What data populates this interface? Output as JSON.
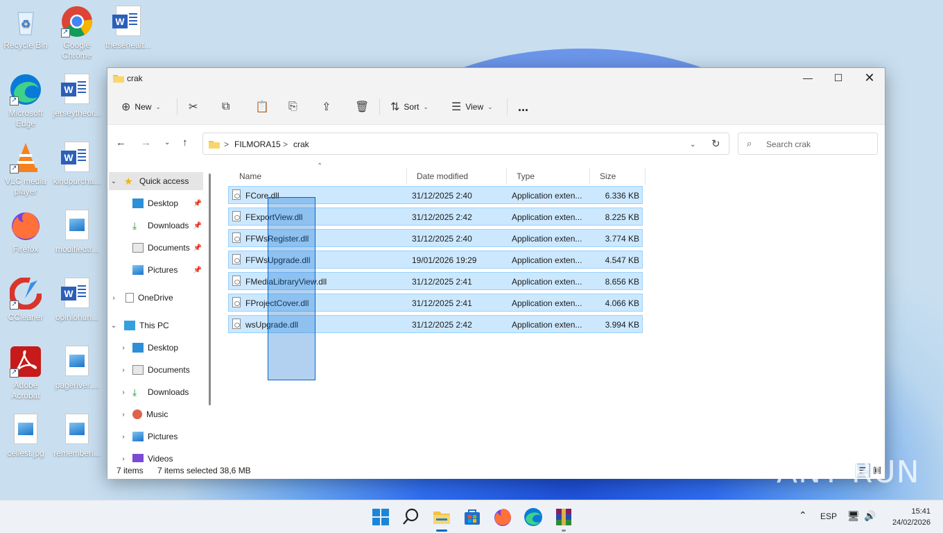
{
  "desktop": {
    "icons": [
      {
        "label": "Recycle Bin",
        "icon": "recycle-bin-icon"
      },
      {
        "label": "Google Chrome",
        "icon": "chrome-icon"
      },
      {
        "label": "thesehealt...",
        "icon": "word-doc-icon"
      },
      {
        "label": "Microsoft Edge",
        "icon": "edge-icon"
      },
      {
        "label": "jerseytheor...",
        "icon": "word-doc-icon"
      },
      {
        "label": "VLC media player",
        "icon": "vlc-icon"
      },
      {
        "label": "kindpurcha...",
        "icon": "word-doc-icon"
      },
      {
        "label": "Firefox",
        "icon": "firefox-icon"
      },
      {
        "label": "modifiedtr...",
        "icon": "image-file-icon"
      },
      {
        "label": "CCleaner",
        "icon": "ccleaner-icon"
      },
      {
        "label": "opinionun...",
        "icon": "word-doc-icon"
      },
      {
        "label": "Adobe Acrobat",
        "icon": "acrobat-icon"
      },
      {
        "label": "pageriver....",
        "icon": "image-file-icon"
      },
      {
        "label": "cellest.jpg",
        "icon": "image-file-icon"
      },
      {
        "label": "rememberi...",
        "icon": "image-file-icon"
      }
    ]
  },
  "explorer": {
    "title": "crak",
    "toolbar": {
      "new_label": "New",
      "sort_label": "Sort",
      "view_label": "View",
      "more_label": "..."
    },
    "address": {
      "crumbs": [
        "FILMORA15",
        "crak"
      ],
      "separator": ">"
    },
    "search": {
      "placeholder": "Search crak"
    },
    "nav": {
      "quick_access": "Quick access",
      "qa_items": [
        "Desktop",
        "Downloads",
        "Documents",
        "Pictures"
      ],
      "onedrive": "OneDrive",
      "this_pc": "This PC",
      "pc_items": [
        "Desktop",
        "Documents",
        "Downloads",
        "Music",
        "Pictures",
        "Videos"
      ]
    },
    "columns": {
      "name": "Name",
      "date": "Date modified",
      "type": "Type",
      "size": "Size"
    },
    "files": [
      {
        "name": "FCore.dll",
        "date": "31/12/2025 2:40",
        "type": "Application exten...",
        "size": "6.336 KB"
      },
      {
        "name": "FExportView.dll",
        "date": "31/12/2025 2:42",
        "type": "Application exten...",
        "size": "8.225 KB"
      },
      {
        "name": "FFWsRegister.dll",
        "date": "31/12/2025 2:40",
        "type": "Application exten...",
        "size": "3.774 KB"
      },
      {
        "name": "FFWsUpgrade.dll",
        "date": "19/01/2026 19:29",
        "type": "Application exten...",
        "size": "4.547 KB"
      },
      {
        "name": "FMediaLibraryView.dll",
        "date": "31/12/2025 2:41",
        "type": "Application exten...",
        "size": "8.656 KB"
      },
      {
        "name": "FProjectCover.dll",
        "date": "31/12/2025 2:41",
        "type": "Application exten...",
        "size": "4.066 KB"
      },
      {
        "name": "wsUpgrade.dll",
        "date": "31/12/2025 2:42",
        "type": "Application exten...",
        "size": "3.994 KB"
      }
    ],
    "status": {
      "count": "7 items",
      "selected": "7 items selected",
      "size": "38,6 MB"
    }
  },
  "taskbar": {
    "lang": "ESP",
    "time": "15:41",
    "date": "24/02/2026"
  },
  "watermark": "ANY RUN",
  "colors": {
    "selection": "#cce8ff",
    "accent": "#0067c0"
  }
}
